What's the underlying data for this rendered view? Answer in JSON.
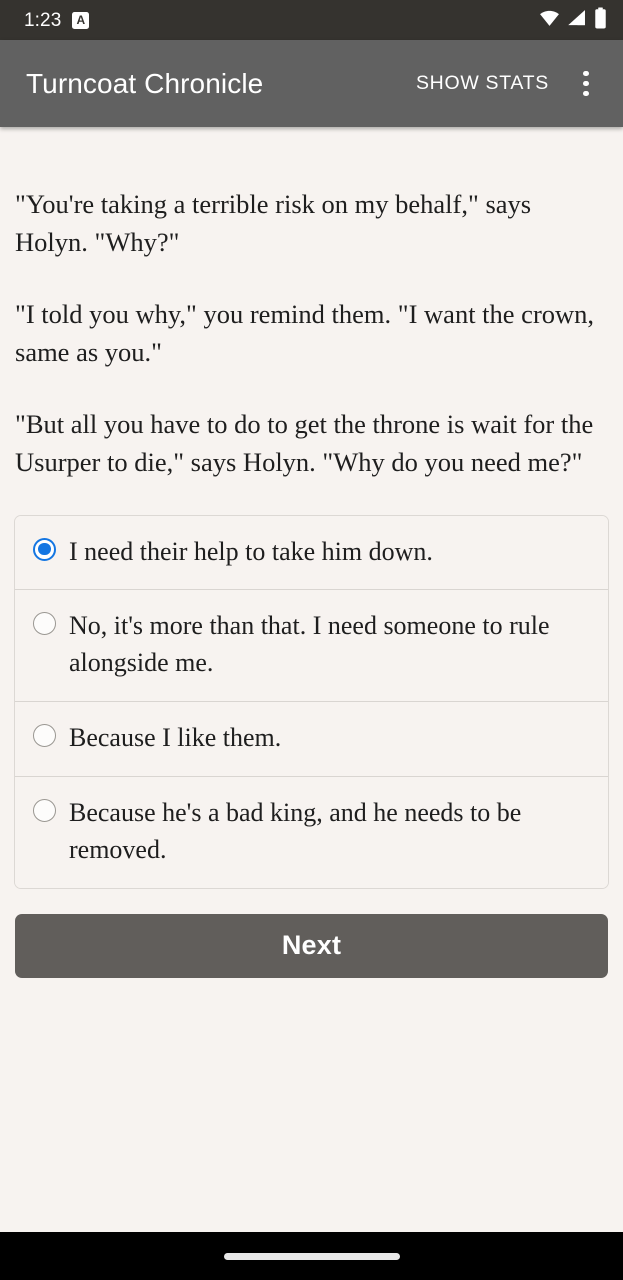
{
  "status_bar": {
    "clock": "1:23",
    "notification_badge_letter": "A",
    "notification_icon": "app-notification-badge-icon",
    "wifi_icon": "wifi-icon",
    "cellular_icon": "cellular-signal-icon",
    "battery_icon": "battery-full-icon",
    "background_color": "#35332F",
    "foreground_color": "#FFFFFF"
  },
  "app_bar": {
    "title": "Turncoat Chronicle",
    "show_stats_label": "SHOW STATS",
    "overflow_icon": "more-vertical-icon",
    "background_color": "#616161",
    "text_color": "#FFFFFF"
  },
  "story": {
    "paragraphs": [
      "\"You're taking a terrible risk on my behalf,\" says Holyn. \"Why?\"",
      "\"I told you why,\" you remind them. \"I want the crown, same as you.\"",
      "\"But all you have to do to get the throne is wait for the Usurper to die,\" says Holyn. \"Why do you need me?\""
    ],
    "p0": "\"You're taking a terrible risk on my behalf,\" says Holyn. \"Why?\"",
    "p1": "\"I told you why,\" you remind them. \"I want the crown, same as you.\"",
    "p2": "\"But all you have to do to get the throne is wait for the Usurper to die,\" says Holyn. \"Why do you need me?\""
  },
  "choices": {
    "selected_index": 0,
    "selected_color": "#1476E2",
    "options": [
      {
        "label": "I need their help to take him down.",
        "selected": true
      },
      {
        "label": "No, it's more than that. I need someone to rule alongside me.",
        "selected": false
      },
      {
        "label": "Because I like them.",
        "selected": false
      },
      {
        "label": "Because he's a bad king, and he needs to be removed.",
        "selected": false
      }
    ],
    "o0": "I need their help to take him down.",
    "o1": "No, it's more than that. I need someone to rule alongside me.",
    "o2": "Because I like them.",
    "o3": "Because he's a bad king, and he needs to be removed."
  },
  "next_button": {
    "label": "Next",
    "background_color": "#615E5B",
    "text_color": "#FFFFFF"
  },
  "nav_bar": {
    "gesture_pill_icon": "home-gesture-pill",
    "background_color": "#000000"
  },
  "page": {
    "background_color": "#F7F3F0",
    "text_color": "#1E1E1E"
  }
}
